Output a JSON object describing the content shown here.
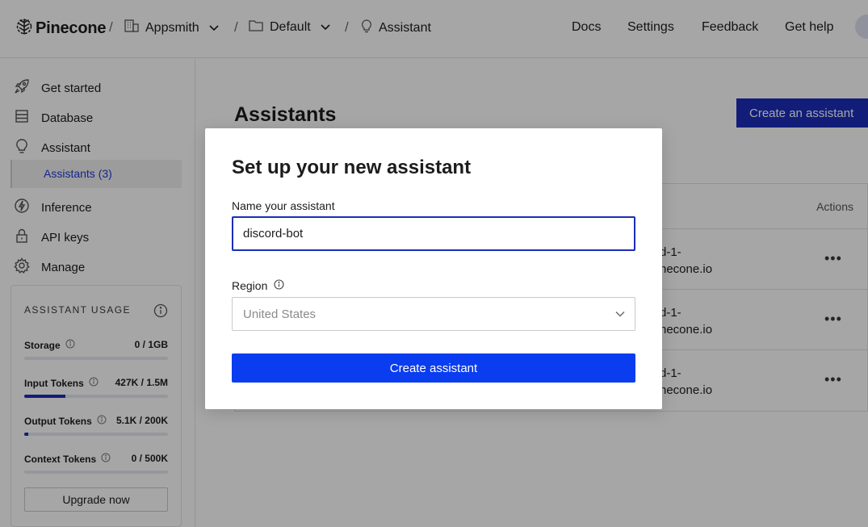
{
  "topbar": {
    "logo_text": "Pinecone",
    "breadcrumb": {
      "org": "Appsmith",
      "project": "Default",
      "section": "Assistant",
      "separator": "/"
    },
    "nav": [
      "Docs",
      "Settings",
      "Feedback",
      "Get help"
    ]
  },
  "sidebar": {
    "items": [
      {
        "label": "Get started",
        "icon": "rocket-icon"
      },
      {
        "label": "Database",
        "icon": "database-icon"
      },
      {
        "label": "Assistant",
        "icon": "bulb-icon"
      },
      {
        "label": "Inference",
        "icon": "inference-icon"
      },
      {
        "label": "API keys",
        "icon": "lock-icon"
      },
      {
        "label": "Manage",
        "icon": "gear-icon"
      }
    ],
    "sub_item": "Assistants (3)",
    "usage": {
      "title": "ASSISTANT USAGE",
      "rows": [
        {
          "label": "Storage",
          "value": "0 / 1GB",
          "fill_fraction": 0.0
        },
        {
          "label": "Input Tokens",
          "value": "427K / 1.5M",
          "fill_fraction": 0.285
        },
        {
          "label": "Output Tokens",
          "value": "5.1K / 200K",
          "fill_fraction": 0.026
        },
        {
          "label": "Context Tokens",
          "value": "0 / 500K",
          "fill_fraction": 0.0
        }
      ],
      "upgrade_label": "Upgrade now"
    }
  },
  "main": {
    "title": "Assistants",
    "create_label": "Create an assistant",
    "table": {
      "actions_header": "Actions",
      "rows": [
        {
          "host": "d-1-\nnecone.io"
        },
        {
          "host": "d-1-\nnecone.io"
        },
        {
          "host": "d-1-\nnecone.io"
        }
      ],
      "row_menu": "•••"
    }
  },
  "modal": {
    "title": "Set up your new assistant",
    "name_label": "Name your assistant",
    "name_value": "discord-bot",
    "region_label": "Region",
    "region_placeholder": "United States",
    "submit_label": "Create assistant"
  },
  "colors": {
    "primary": "#0a3df0",
    "primary_dark": "#1b2db8",
    "link": "#1f3bd6"
  }
}
